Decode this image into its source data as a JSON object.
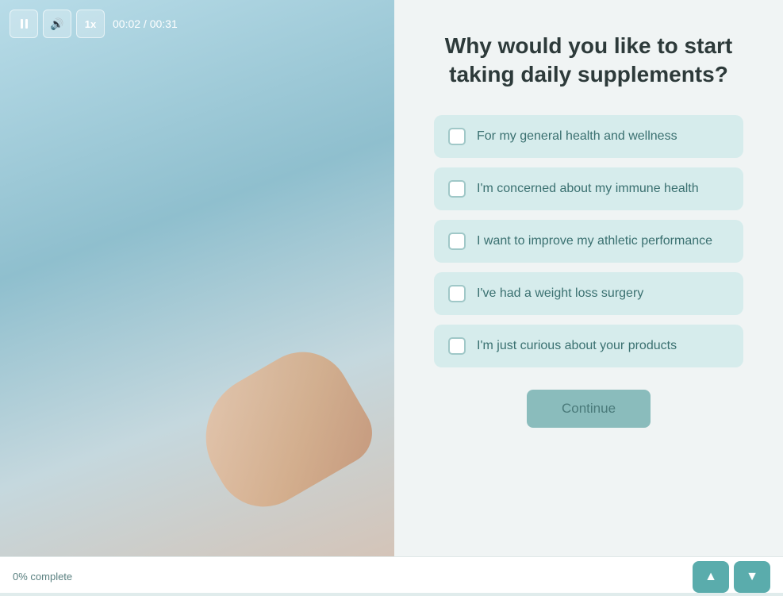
{
  "video": {
    "time_current": "00:02",
    "time_total": "00:31",
    "time_display": "00:02 / 00:31",
    "speed_label": "1x",
    "pause_icon": "pause-icon",
    "volume_icon": "volume-icon"
  },
  "question": {
    "title": "Why would you like to start taking daily supplements?",
    "options": [
      {
        "id": "opt1",
        "label": "For my general health and wellness"
      },
      {
        "id": "opt2",
        "label": "I'm concerned about my immune health"
      },
      {
        "id": "opt3",
        "label": "I want to improve my athletic performance"
      },
      {
        "id": "opt4",
        "label": "I've had a weight loss surgery"
      },
      {
        "id": "opt5",
        "label": "I'm just curious about your products"
      }
    ],
    "continue_label": "Continue"
  },
  "progress": {
    "text": "0% complete",
    "percent": 0
  },
  "nav": {
    "up_label": "▲",
    "down_label": "▼"
  }
}
